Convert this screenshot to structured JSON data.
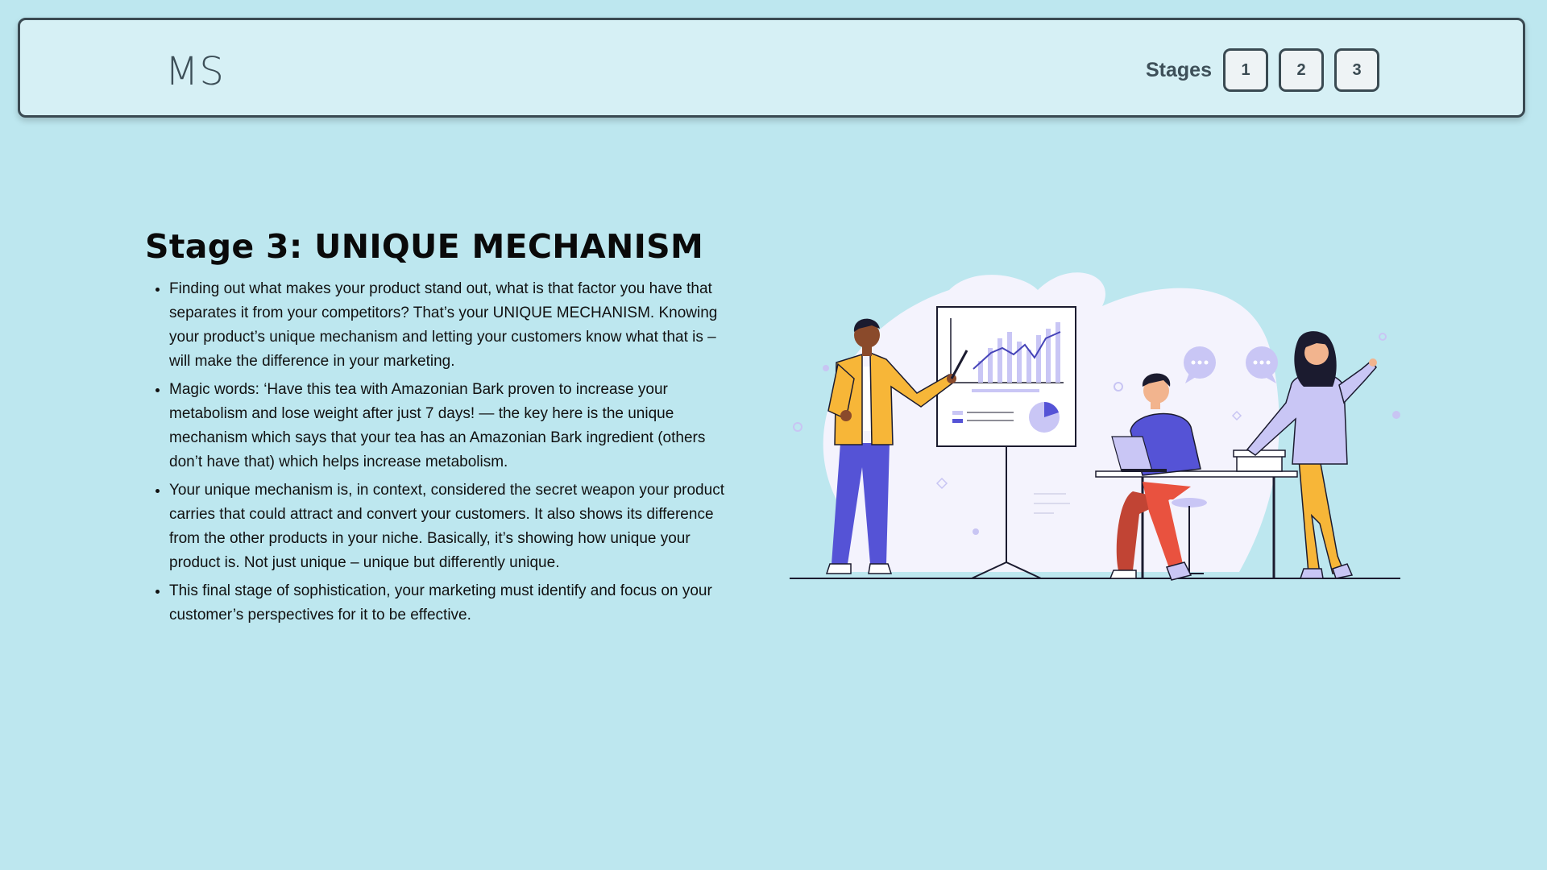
{
  "header": {
    "logo": "MS",
    "stages_label": "Stages",
    "stages": [
      "1",
      "2",
      "3"
    ]
  },
  "main": {
    "title": "Stage 3: UNIQUE MECHANISM",
    "bullets": [
      "Finding out what makes your product stand out, what is that factor you have that separates it from your competitors? That’s your UNIQUE MECHANISM. Knowing your product’s unique mechanism and letting your customers know what that is – will make the difference in your marketing.",
      "Magic words: ‘Have this tea with Amazonian Bark proven to increase your metabolism and lose weight after just 7 days! — the key here is the unique mechanism which says that your tea has an Amazonian Bark ingredient (others don’t have that) which helps increase metabolism.",
      "Your unique mechanism is, in context, considered the secret weapon your product carries that could attract and convert your customers. It also shows its difference from the other products in your niche. Basically, it’s showing how unique your product is. Not just unique – unique but differently unique.",
      "This final stage of sophistication, your marketing must identify and focus on your customer’s perspectives for it to be effective."
    ]
  },
  "colors": {
    "background": "#bde7ef",
    "header_bg": "#d6f0f5",
    "border": "#3a4a52",
    "accent_purple": "#5553d6",
    "accent_orange": "#f7b638",
    "accent_red": "#e9523f"
  }
}
